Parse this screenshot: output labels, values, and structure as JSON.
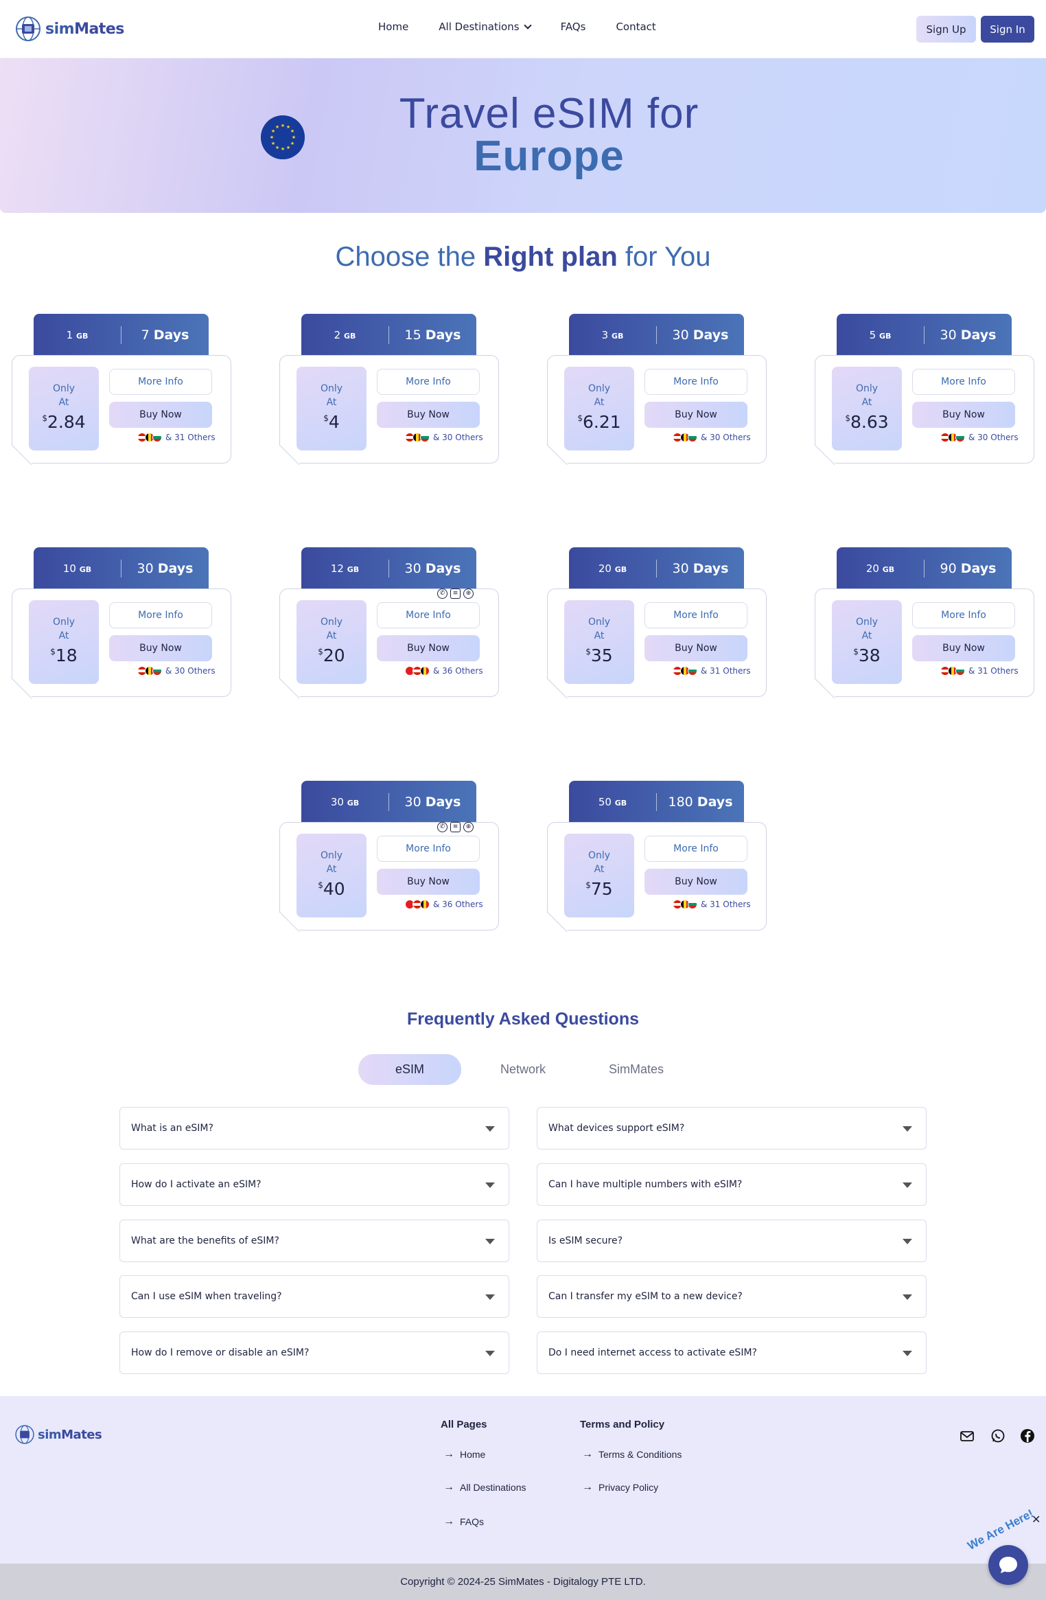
{
  "header": {
    "logo_text_1": "sim",
    "logo_text_2": "Mates",
    "nav": [
      "Home",
      "All Destinations",
      "FAQs",
      "Contact"
    ],
    "signup": "Sign Up",
    "signin": "Sign In"
  },
  "hero": {
    "title_line1": "Travel eSIM for",
    "title_line2": "Europe"
  },
  "section": {
    "title_a": "Choose the ",
    "title_b": "Right plan",
    "title_c": " for You"
  },
  "plan_labels": {
    "only": "Only",
    "at": "At",
    "currency": "$",
    "gb_unit": "GB",
    "days_unit": "Days",
    "more_info": "More Info",
    "buy_now": "Buy Now"
  },
  "plans": [
    {
      "gb": "1",
      "days": "7",
      "price": "2.84",
      "others": "& 31 Others"
    },
    {
      "gb": "2",
      "days": "15",
      "price": "4",
      "others": "& 30 Others"
    },
    {
      "gb": "3",
      "days": "30",
      "price": "6.21",
      "others": "& 30 Others"
    },
    {
      "gb": "5",
      "days": "30",
      "price": "8.63",
      "others": "& 30 Others"
    },
    {
      "gb": "10",
      "days": "30",
      "price": "18",
      "others": "& 30 Others"
    },
    {
      "gb": "12",
      "days": "30",
      "price": "20",
      "others": "& 36 Others"
    },
    {
      "gb": "20",
      "days": "30",
      "price": "35",
      "others": "& 31 Others"
    },
    {
      "gb": "20",
      "days": "90",
      "price": "38",
      "others": "& 31 Others"
    },
    {
      "gb": "30",
      "days": "30",
      "price": "40",
      "others": "& 36 Others"
    },
    {
      "gb": "50",
      "days": "180",
      "price": "75",
      "others": "& 31 Others"
    }
  ],
  "faq": {
    "title": "Frequently Asked Questions",
    "tabs": [
      "eSIM",
      "Network",
      "SimMates"
    ],
    "left": [
      "What is an eSIM?",
      "How do I activate an eSIM?",
      "What are the benefits of eSIM?",
      "Can I use eSIM when traveling?",
      "How do I remove or disable an eSIM?"
    ],
    "right": [
      "What devices support eSIM?",
      "Can I have multiple numbers with eSIM?",
      "Is eSIM secure?",
      "Can I transfer my eSIM to a new device?",
      "Do I need internet access to activate eSIM?"
    ]
  },
  "footer": {
    "col1_title": "All Pages",
    "col1_links": [
      "Home",
      "All Destinations",
      "FAQs"
    ],
    "col2_title": "Terms and Policy",
    "col2_links": [
      "Terms & Conditions",
      "Privacy Policy"
    ],
    "copyright": "Copyright © 2024-25 SimMates - Digitalogy PTE LTD.",
    "chat_label": "We Are Here!"
  },
  "colors": {
    "primary": "#3b4a9e",
    "accent": "#3d6bb0",
    "hero_bg": "#cdd5fb"
  }
}
